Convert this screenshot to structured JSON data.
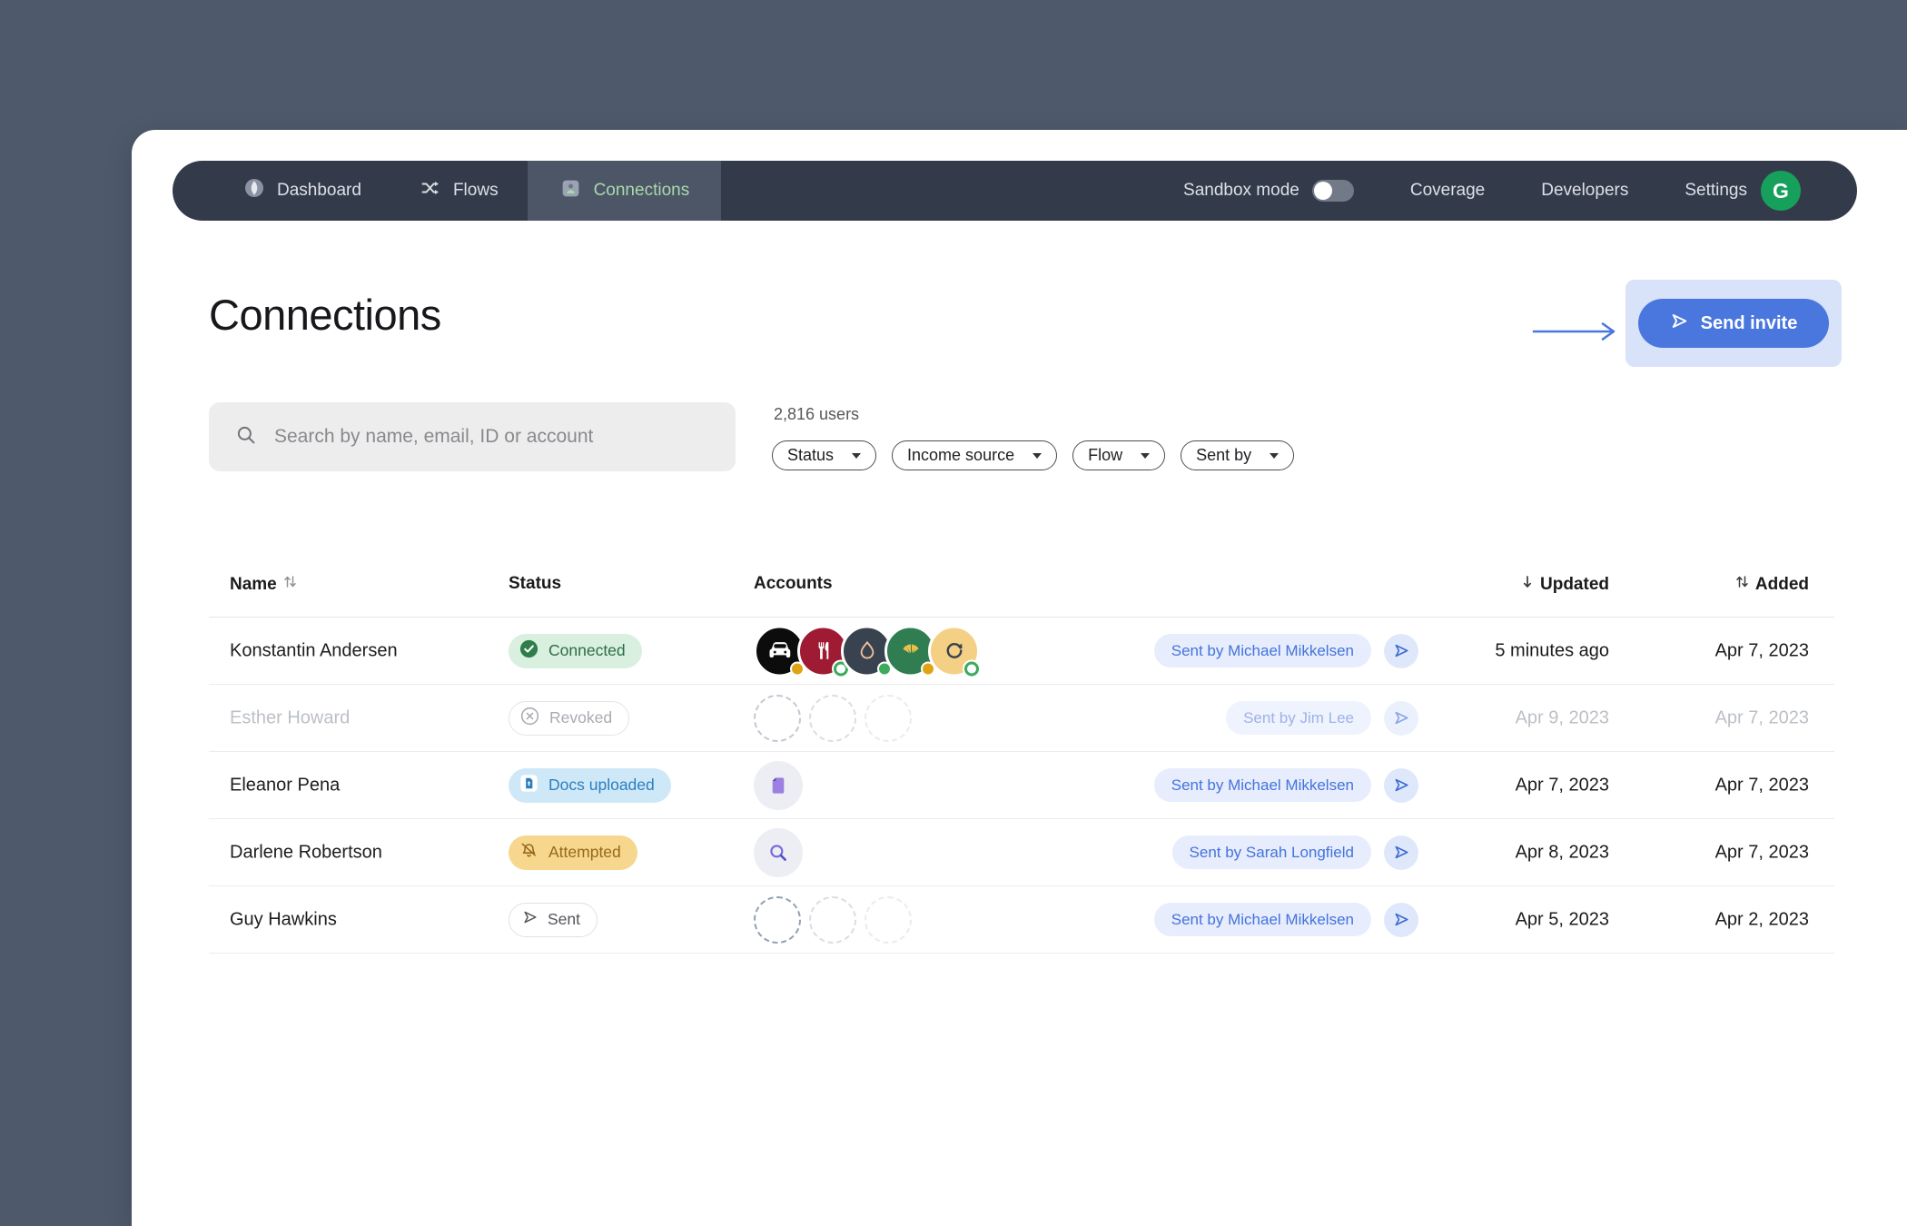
{
  "nav": {
    "items": [
      {
        "label": "Dashboard",
        "icon": "dashboard-icon"
      },
      {
        "label": "Flows",
        "icon": "shuffle-icon"
      },
      {
        "label": "Connections",
        "icon": "person-card-icon",
        "active": true
      }
    ],
    "sandbox_label": "Sandbox mode",
    "sandbox_on": false,
    "links": [
      {
        "label": "Coverage"
      },
      {
        "label": "Developers"
      },
      {
        "label": "Settings"
      }
    ],
    "avatar_letter": "G"
  },
  "page": {
    "title": "Connections",
    "send_invite_label": "Send invite"
  },
  "search": {
    "placeholder": "Search by name, email, ID or account"
  },
  "filters": {
    "users_count": "2,816 users",
    "pills": [
      {
        "label": "Status"
      },
      {
        "label": "Income source"
      },
      {
        "label": "Flow"
      },
      {
        "label": "Sent by"
      }
    ]
  },
  "table": {
    "headers": {
      "name": "Name",
      "status": "Status",
      "accounts": "Accounts",
      "updated": "Updated",
      "added": "Added"
    },
    "rows": [
      {
        "name": "Konstantin Andersen",
        "status": "Connected",
        "accounts": [
          {
            "icon": "car-icon",
            "dot": "amber"
          },
          {
            "icon": "fork-knife-icon",
            "dot": "green-ring"
          },
          {
            "icon": "droplet-icon",
            "dot": "green"
          },
          {
            "icon": "croissant-icon",
            "dot": "amber"
          },
          {
            "icon": "refresh-icon",
            "dot": "green-ring"
          }
        ],
        "sent_by": "Sent by Michael Mikkelsen",
        "updated": "5 minutes ago",
        "added": "Apr 7, 2023"
      },
      {
        "name": "Esther Howard",
        "status": "Revoked",
        "muted": true,
        "accounts": [
          {
            "icon": "empty-dashed-circle"
          },
          {
            "icon": "empty-dashed-circle"
          },
          {
            "icon": "empty-dashed-circle"
          }
        ],
        "sent_by": "Sent by Jim Lee",
        "updated": "Apr 9, 2023",
        "added": "Apr 7, 2023"
      },
      {
        "name": "Eleanor Pena",
        "status": "Docs uploaded",
        "accounts": [
          {
            "icon": "document-icon"
          }
        ],
        "sent_by": "Sent by Michael Mikkelsen",
        "updated": "Apr 7, 2023",
        "added": "Apr 7, 2023"
      },
      {
        "name": "Darlene Robertson",
        "status": "Attempted",
        "accounts": [
          {
            "icon": "magnifier-icon"
          }
        ],
        "sent_by": "Sent by Sarah Longfield",
        "updated": "Apr 8, 2023",
        "added": "Apr 7, 2023"
      },
      {
        "name": "Guy Hawkins",
        "status": "Sent",
        "accounts": [
          {
            "icon": "empty-dashed-circle"
          },
          {
            "icon": "empty-dashed-circle"
          },
          {
            "icon": "empty-dashed-circle"
          }
        ],
        "sent_by": "Sent by Michael Mikkelsen",
        "updated": "Apr 5, 2023",
        "added": "Apr 2, 2023"
      }
    ]
  },
  "colors": {
    "background": "#4e5a6b",
    "nav": "#333b4a",
    "nav_active_tab": "#4d5666",
    "nav_active_text": "#a8d9ac",
    "accent_blue": "#4a77dd",
    "invite_highlight": "#d8e2f8",
    "connected_green": "#2b6e43",
    "attempted_amber": "#96681b",
    "docs_blue": "#2a7fc0",
    "avatar_green": "#16a05c"
  }
}
